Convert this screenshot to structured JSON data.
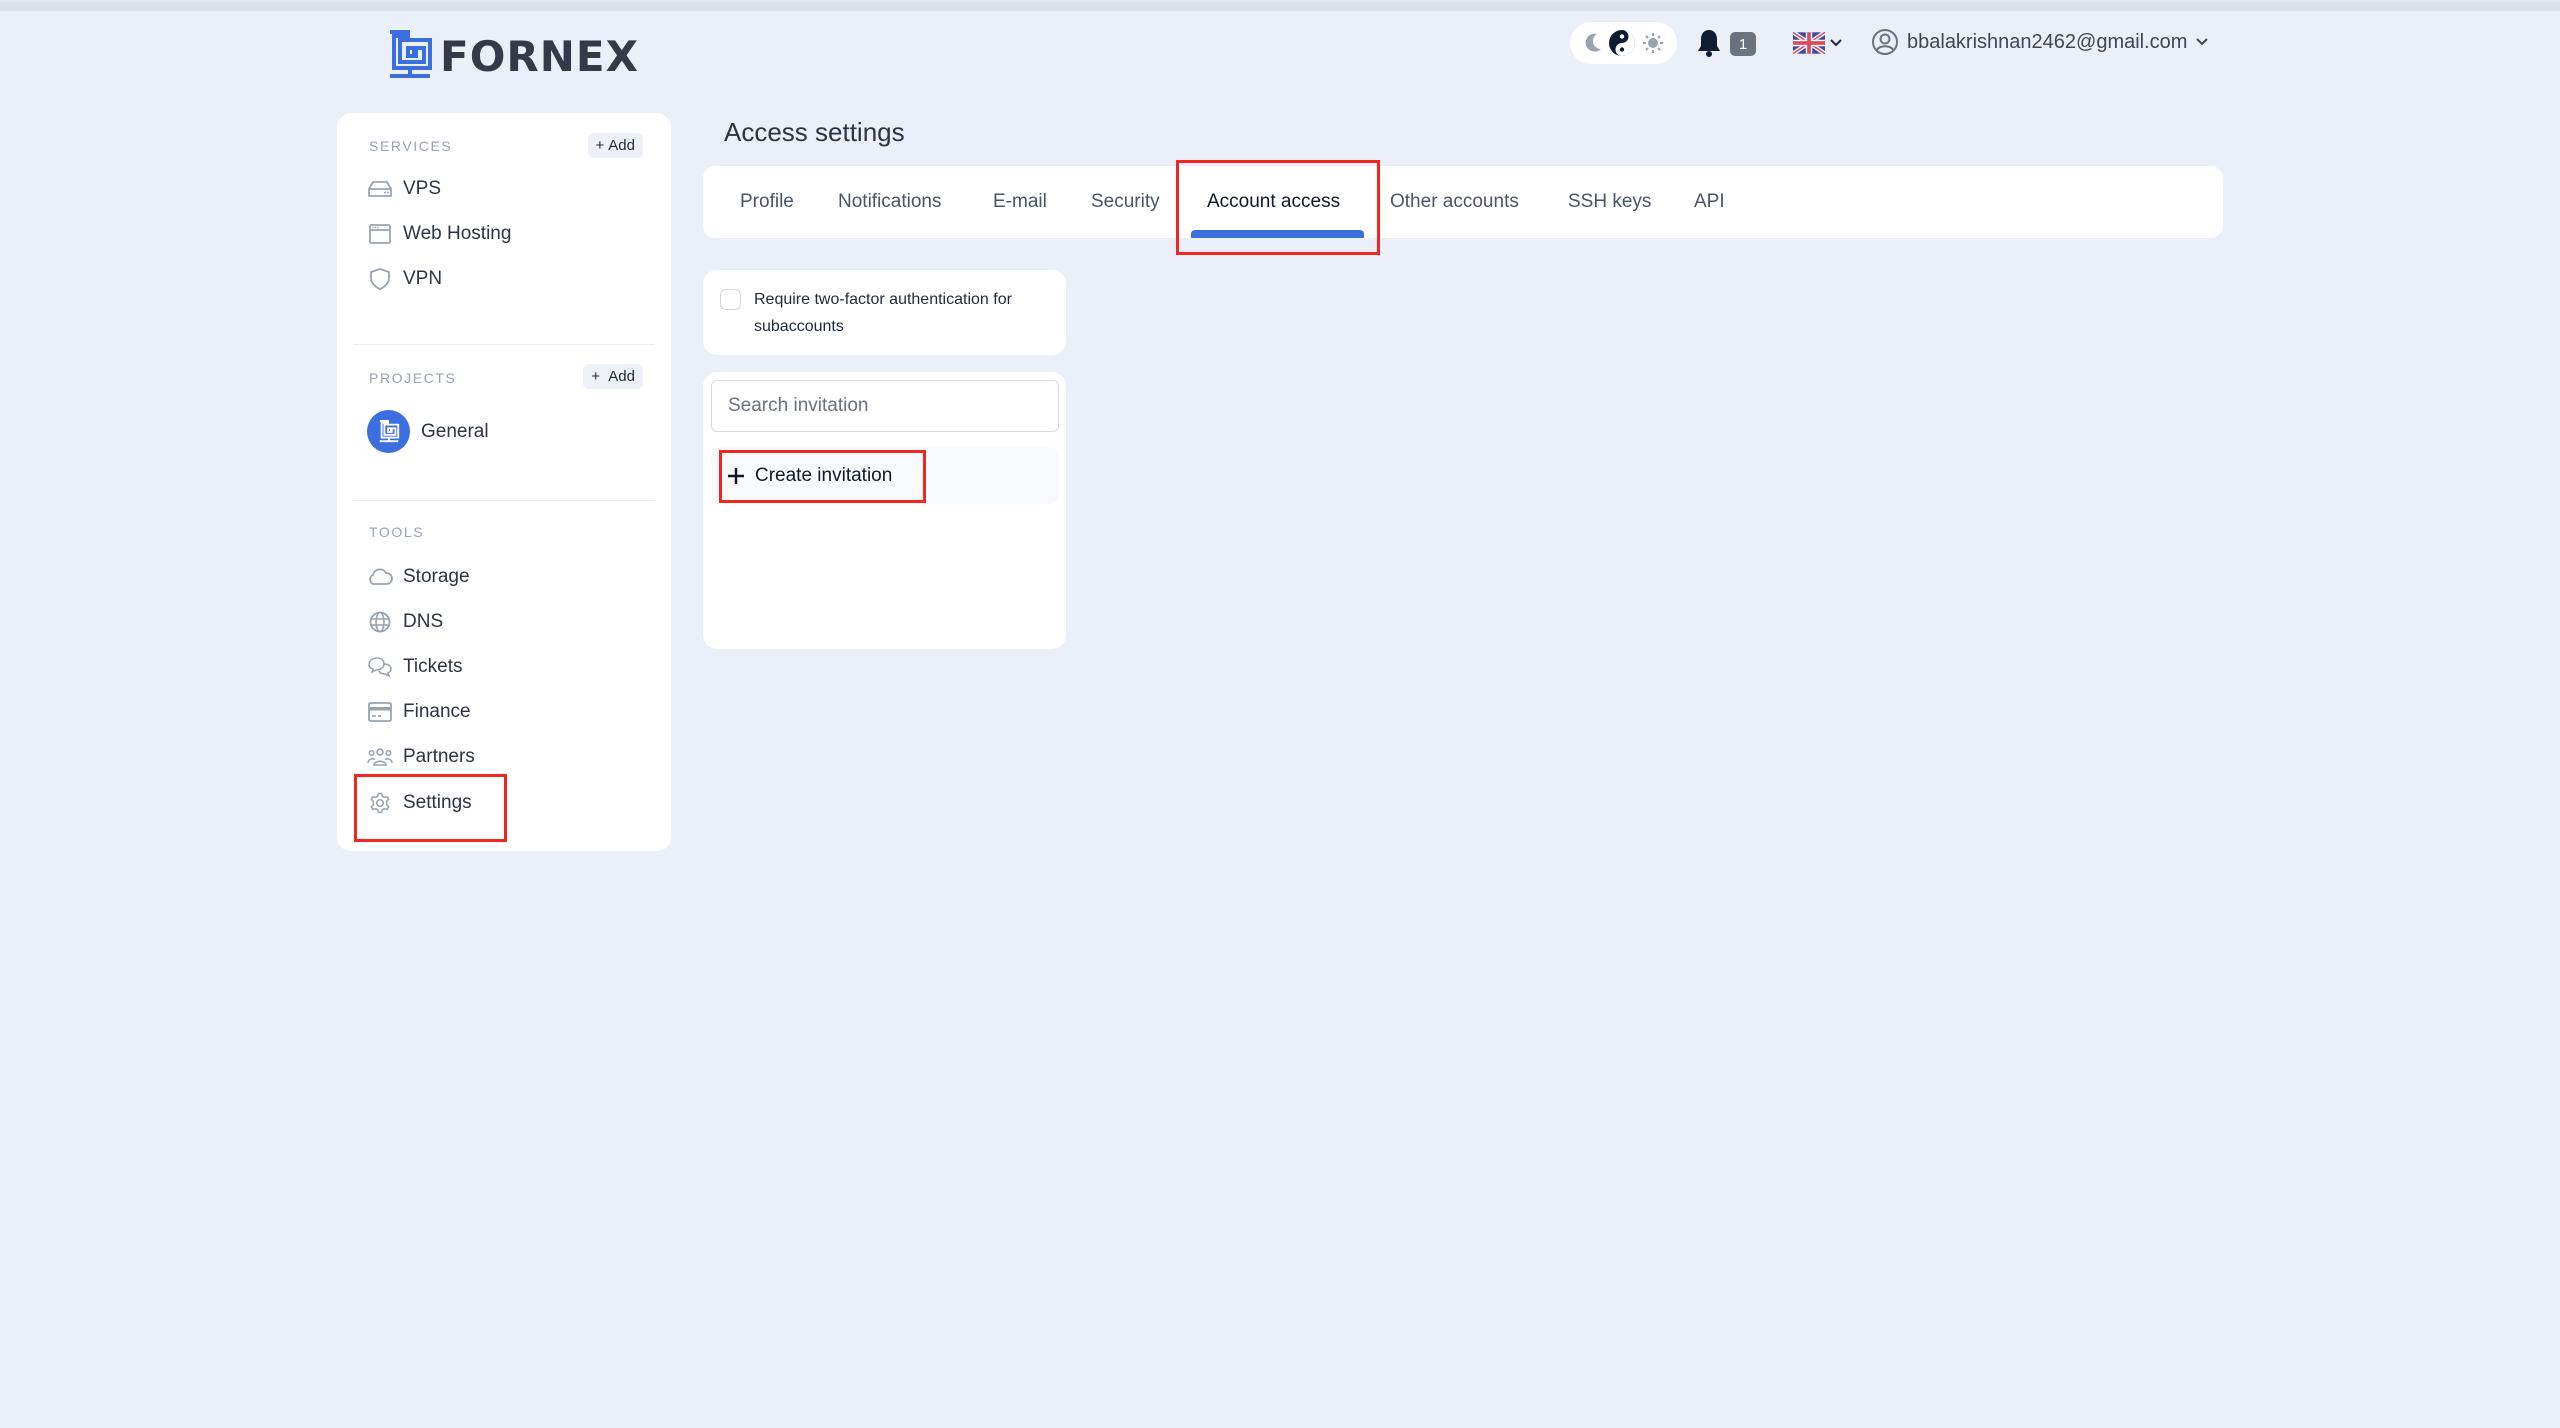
{
  "header": {
    "logo_text": "FORNEX",
    "theme_options": [
      "moon-icon",
      "yin-yang-icon",
      "sun-icon"
    ],
    "theme_selected": "auto",
    "notifications_count": "1",
    "language": "en-GB",
    "user_email": "bbalakrishnan2462@gmail.com"
  },
  "sidebar": {
    "services": {
      "heading": "SERVICES",
      "add_label": "Add",
      "items": [
        {
          "label": "VPS",
          "icon": "server-icon"
        },
        {
          "label": "Web Hosting",
          "icon": "browser-window-icon"
        },
        {
          "label": "VPN",
          "icon": "shield-icon"
        }
      ]
    },
    "projects": {
      "heading": "PROJECTS",
      "add_label": "Add",
      "items": [
        {
          "label": "General",
          "icon": "fornex-logo-icon"
        }
      ]
    },
    "tools": {
      "heading": "TOOLS",
      "items": [
        {
          "label": "Storage",
          "icon": "cloud-icon"
        },
        {
          "label": "DNS",
          "icon": "globe-icon"
        },
        {
          "label": "Tickets",
          "icon": "chat-bubbles-icon"
        },
        {
          "label": "Finance",
          "icon": "credit-card-icon"
        },
        {
          "label": "Partners",
          "icon": "users-group-icon"
        },
        {
          "label": "Settings",
          "icon": "gear-icon"
        }
      ]
    }
  },
  "main": {
    "title": "Access settings",
    "tabs": [
      {
        "label": "Profile"
      },
      {
        "label": "Notifications"
      },
      {
        "label": "E-mail"
      },
      {
        "label": "Security"
      },
      {
        "label": "Account access",
        "active": true
      },
      {
        "label": "Other accounts"
      },
      {
        "label": "SSH keys"
      },
      {
        "label": "API"
      }
    ],
    "tfa": {
      "label": "Require two-factor authentication for subaccounts",
      "checked": false
    },
    "invitations": {
      "search_placeholder": "Search invitation",
      "search_value": "",
      "create_label": "Create invitation"
    }
  },
  "colors": {
    "accent": "#3b6fe0",
    "background": "#ebeff7",
    "highlight": "#f0261f"
  }
}
